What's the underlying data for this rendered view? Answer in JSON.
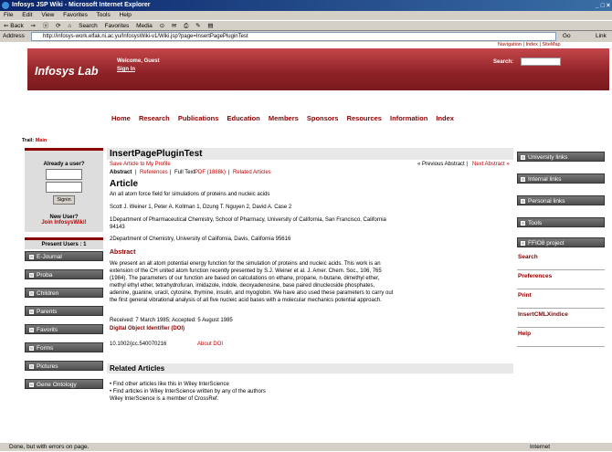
{
  "window": {
    "title": "Infosys JSP Wiki - Microsoft Internet Explorer",
    "controls": "_ □ ×"
  },
  "menubar": [
    "File",
    "Edit",
    "View",
    "Favorites",
    "Tools",
    "Help"
  ],
  "toolbar": [
    "⇐ Back",
    "⇒",
    "ⓧ",
    "⟳",
    "⌂",
    "Search",
    "Favorites",
    "Media",
    "⊙",
    "✉",
    "⎙",
    "✎",
    "▤"
  ],
  "address": {
    "label": "Address",
    "url": "http://infosys-work.elfak.ni.ac.yu/InfosysWiki-v1/Wiki.jsp?page=InsertPagePluginTest",
    "go": "Go",
    "links": "Link"
  },
  "toplinks": "Navigation | Index | SiteMap",
  "header": {
    "logo": "Infosys Lab",
    "welcome": "Welcome, Guest",
    "signin": "Sign In",
    "search_label": "Search:"
  },
  "nav": [
    "Home",
    "Research",
    "Publications",
    "Education",
    "Members",
    "Sponsors",
    "Resources",
    "Information",
    "Index"
  ],
  "trail": {
    "label": "Trail:",
    "link": "Main"
  },
  "left": {
    "user_title": "Already a user?",
    "signin_btn": "Signin",
    "new_user": "New User?",
    "join": "Join InfosysWiki!",
    "present": "Present Users : 1",
    "buttons": [
      "E-Journal",
      "Proba",
      "Children",
      "Parents",
      "Favorits",
      "Forms",
      "Pictures",
      "Gene Ontology"
    ]
  },
  "content": {
    "page_title": "InsertPagePluginTest",
    "save_article": "Save Article to My Profile",
    "prev_next_prev": "« Previous Abstract |",
    "prev_next_next": "Next Abstract »",
    "tabs_abstract": "Abstract",
    "tabs_references": "References",
    "tabs_fulltext": "Full Text:",
    "tabs_pdf": "PDF (1888k)",
    "tabs_related": "Related Articles",
    "article_heading": "Article",
    "article_title": "An all atom force field for simulations of proteins and nucleic acids",
    "authors": "Scott J. Weiner 1, Peter A. Kollman 1, Dzung T. Nguyen 2, David A. Case 2",
    "affil1a": "1Department of Pharmaceutical Chemistry, School of Pharmacy, University of California, San Francisco, California",
    "affil1b": "94143",
    "affil2": "2Department of Chemistry, University of California, Davis, California 95616",
    "abstract_heading": "Abstract",
    "abstract_lines": [
      "We present an all atom potential energy function for the simulation of proteins and nucleic acids. This work is an",
      "extension of the CH united atom function recently presented by S.J. Weiner et al. J. Amer. Chem. Soc., 106, 765",
      "(1984). The parameters of our function are based on calculations on ethane, propane, n-butane, dimethyl ether,",
      "methyl ethyl ether, tetrahydrofuran, imidazole, indole, deoxyadenosine, base paired dinucleoside phosphates,",
      "adenine, guanine, uracil, cytosine, thymine, insulin, and myoglobin. We have also used these parameters to carry out",
      "the first general vibrational analysis of all five nucleic acid bases with a molecular mechanics potential approach."
    ],
    "received": "Received: 7 March 1985; Accepted: 5 August 1985",
    "doi_heading": "Digital Object Identifier (DOI)",
    "doi": "10.1002/jcc.540070216",
    "about_doi": "About DOI",
    "related_heading": "Related Articles",
    "related1": "•  Find other articles like this in Wiley InterScience",
    "related2": "•  Find articles in Wiley InterScience written by any of the authors",
    "related3": "Wiley InterScience is a member of CrossRef."
  },
  "right": {
    "buttons": [
      "University links",
      "Internal links",
      "Personal links",
      "Tools",
      "FFIO8 project"
    ],
    "links": [
      "Search",
      "Preferences",
      "Print",
      "InsertCMLXindice",
      "Help"
    ]
  },
  "status": {
    "text": "Done, but with errors on page.",
    "zone": "Internet"
  }
}
